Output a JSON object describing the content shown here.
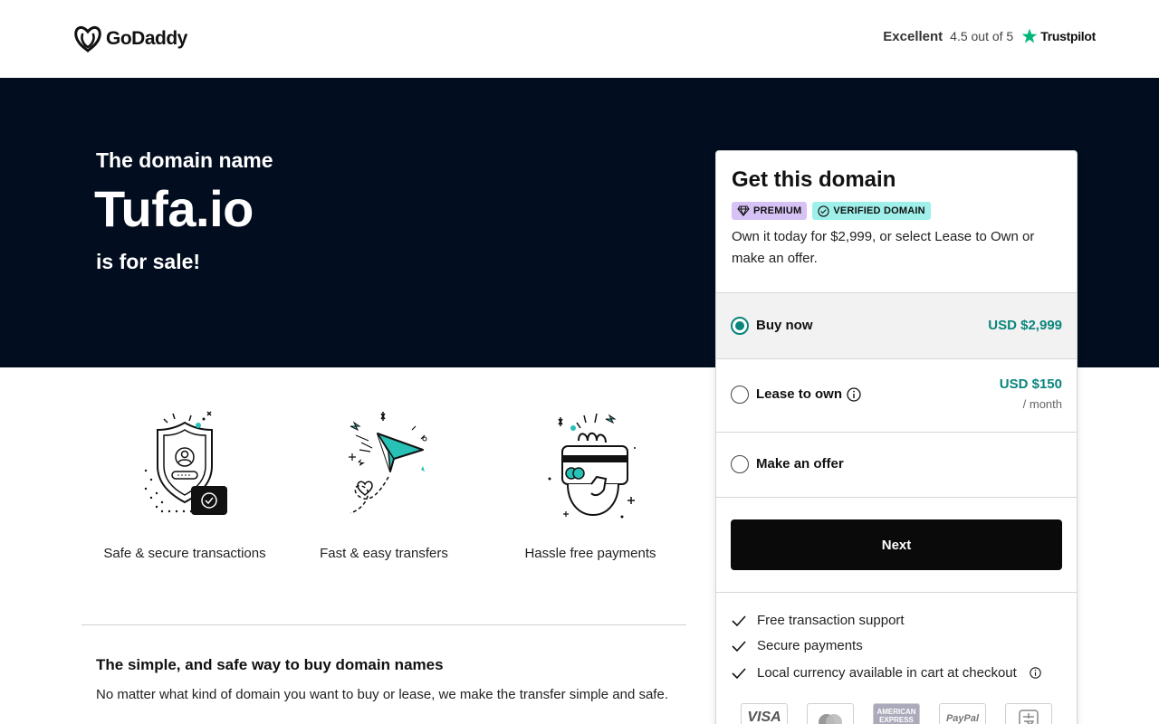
{
  "header": {
    "logo_text": "GoDaddy",
    "trust_rating_word": "Excellent",
    "trust_score": "4.5 out of 5",
    "trust_brand": "Trustpilot"
  },
  "hero": {
    "pre": "The domain name",
    "domain": "Tufa.io",
    "post": "is for sale!"
  },
  "features": [
    {
      "label": "Safe & secure transactions",
      "icon": "shield-check-icon"
    },
    {
      "label": "Fast & easy transfers",
      "icon": "paper-plane-icon"
    },
    {
      "label": "Hassle free payments",
      "icon": "hand-card-icon"
    }
  ],
  "info": {
    "title": "The simple, and safe way to buy domain names",
    "body": "No matter what kind of domain you want to buy or lease, we make the transfer simple and safe."
  },
  "card": {
    "title": "Get this domain",
    "badges": {
      "premium": "PREMIUM",
      "verified": "VERIFIED DOMAIN"
    },
    "description": "Own it today for $2,999, or select Lease to Own or make an offer.",
    "options": {
      "buy": {
        "label": "Buy now",
        "price": "USD $2,999",
        "selected": true
      },
      "lease": {
        "label": "Lease to own",
        "price": "USD $150",
        "sub": "/ month",
        "selected": false
      },
      "offer": {
        "label": "Make an offer",
        "selected": false
      }
    },
    "next_label": "Next",
    "bullets": [
      "Free transaction support",
      "Secure payments",
      "Local currency available in cart at checkout"
    ],
    "payments": {
      "visa": "VISA",
      "amex": "AMERICAN EXPRESS",
      "paypal": "PayPal"
    }
  },
  "colors": {
    "hero_bg": "#020d1f",
    "accent_teal": "#09857c",
    "premium_badge": "#d7c2f5",
    "verified_badge": "#9ff0ea",
    "button_bg": "#0a0a0a"
  }
}
